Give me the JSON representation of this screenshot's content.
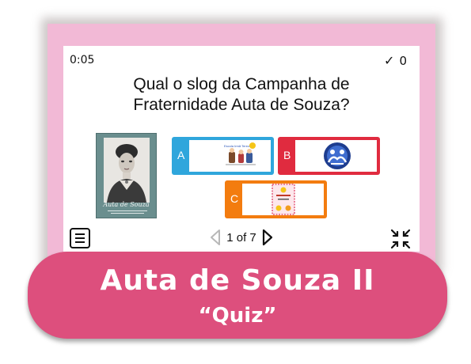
{
  "quiz": {
    "timer": "0:05",
    "score": "0",
    "question": "Qual o slog da Campanha de Fraternidade Auta de Souza?",
    "portrait_caption": "Auta de Souza",
    "answers": [
      {
        "letter": "A",
        "color": "#2fa6dc",
        "image_label": "Escola Irmã Terezinha"
      },
      {
        "letter": "B",
        "color": "#e02b3f"
      },
      {
        "letter": "C",
        "color": "#f37c0f"
      }
    ],
    "pager": {
      "label": "1 of 7"
    }
  },
  "banner": {
    "title": "Auta de Souza II",
    "subtitle": "“Quiz”",
    "color": "#dd4f7d"
  },
  "frame_color": "#f2b9d6",
  "icons": [
    "check-icon",
    "menu-icon",
    "prev-arrow-icon",
    "next-arrow-icon",
    "collapse-icon"
  ]
}
